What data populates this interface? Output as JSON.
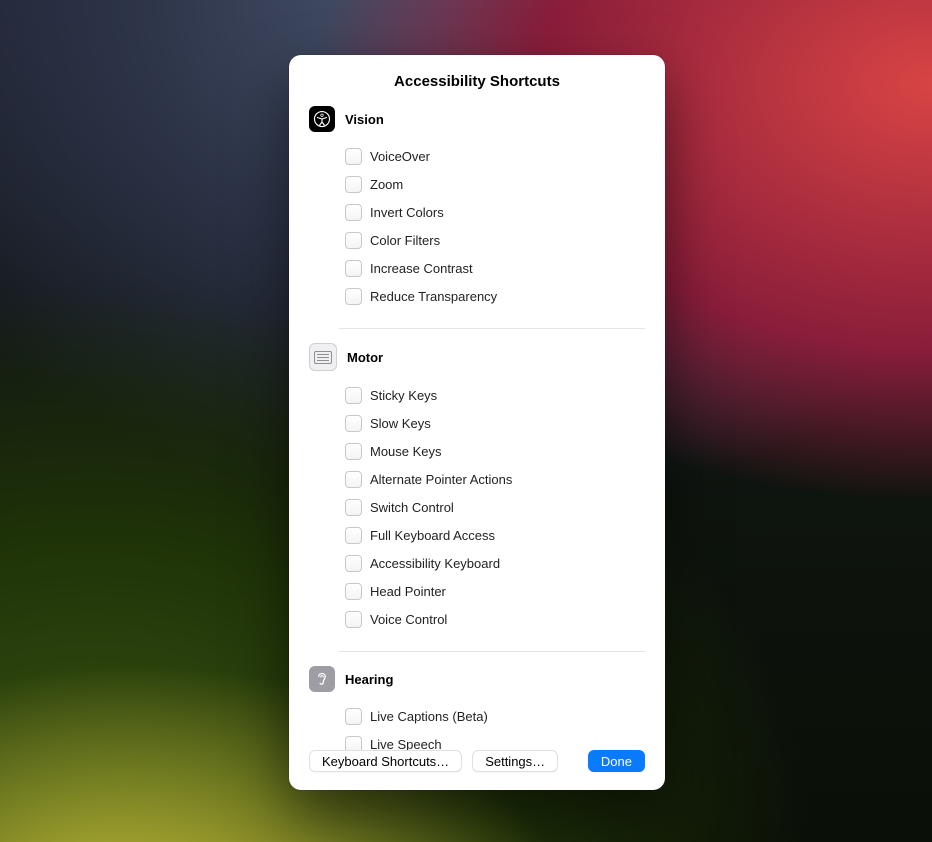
{
  "title": "Accessibility Shortcuts",
  "sections": [
    {
      "id": "vision",
      "title": "Vision",
      "icon": "accessibility-icon",
      "items": [
        {
          "label": "VoiceOver"
        },
        {
          "label": "Zoom"
        },
        {
          "label": "Invert Colors"
        },
        {
          "label": "Color Filters"
        },
        {
          "label": "Increase Contrast"
        },
        {
          "label": "Reduce Transparency"
        }
      ]
    },
    {
      "id": "motor",
      "title": "Motor",
      "icon": "keyboard-icon",
      "items": [
        {
          "label": "Sticky Keys"
        },
        {
          "label": "Slow Keys"
        },
        {
          "label": "Mouse Keys"
        },
        {
          "label": "Alternate Pointer Actions"
        },
        {
          "label": "Switch Control"
        },
        {
          "label": "Full Keyboard Access"
        },
        {
          "label": "Accessibility Keyboard"
        },
        {
          "label": "Head Pointer"
        },
        {
          "label": "Voice Control"
        }
      ]
    },
    {
      "id": "hearing",
      "title": "Hearing",
      "icon": "ear-icon",
      "items": [
        {
          "label": "Live Captions (Beta)"
        },
        {
          "label": "Live Speech"
        }
      ]
    }
  ],
  "footer": {
    "keyboard_shortcuts": "Keyboard Shortcuts…",
    "settings": "Settings…",
    "done": "Done"
  }
}
